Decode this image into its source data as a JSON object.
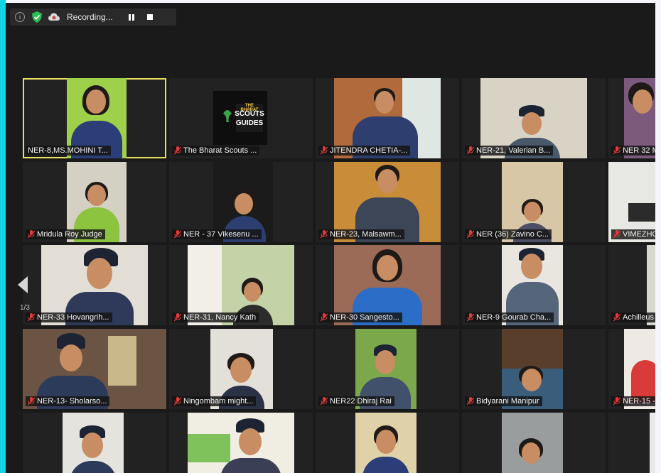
{
  "toolbar": {
    "recording_label": "Recording...",
    "icons": [
      "info-icon",
      "shield-check-icon",
      "cloud-record-icon",
      "pause-icon",
      "stop-icon"
    ]
  },
  "pagination": {
    "label": "1/3"
  },
  "logo": {
    "line1": "THE BHARAT",
    "line2": "SCOUTS",
    "line3": "GUIDES"
  },
  "participants": [
    {
      "name": "NER-8,MS.MOHINI T...",
      "active": true,
      "muted": false
    },
    {
      "name": "The Bharat Scouts ...",
      "muted": true
    },
    {
      "name": "JITENDRA CHETIA-...",
      "muted": true
    },
    {
      "name": "NER-21, Valerian B...",
      "muted": true
    },
    {
      "name": "NER 32 M",
      "muted": true
    },
    {
      "name": "Mridula Roy Judge",
      "muted": true
    },
    {
      "name": "NER - 37 Vikesenu ...",
      "muted": true
    },
    {
      "name": "NER-23, Malsawm...",
      "muted": true
    },
    {
      "name": "NER (36) Zavino C...",
      "muted": true
    },
    {
      "name": "VIMEZHO",
      "muted": true
    },
    {
      "name": "NER-33 Hovangrih...",
      "muted": true
    },
    {
      "name": "NER-31, Nancy Kath",
      "muted": true
    },
    {
      "name": "NER-30 Sangesto...",
      "muted": true
    },
    {
      "name": "NER-9 Gourab Cha...",
      "muted": true
    },
    {
      "name": "Achilleus",
      "muted": true
    },
    {
      "name": "NER-13- Sholarso...",
      "muted": true
    },
    {
      "name": "Ningombam might...",
      "muted": true
    },
    {
      "name": "NER22 Dhiraj Rai",
      "muted": true
    },
    {
      "name": "Bidyarani Manipur",
      "muted": true
    },
    {
      "name": "NER-15 -",
      "muted": true
    },
    {
      "name": "",
      "muted": false
    },
    {
      "name": "",
      "muted": false
    },
    {
      "name": "",
      "muted": false
    },
    {
      "name": "",
      "muted": false
    },
    {
      "name": "",
      "muted": false
    }
  ]
}
